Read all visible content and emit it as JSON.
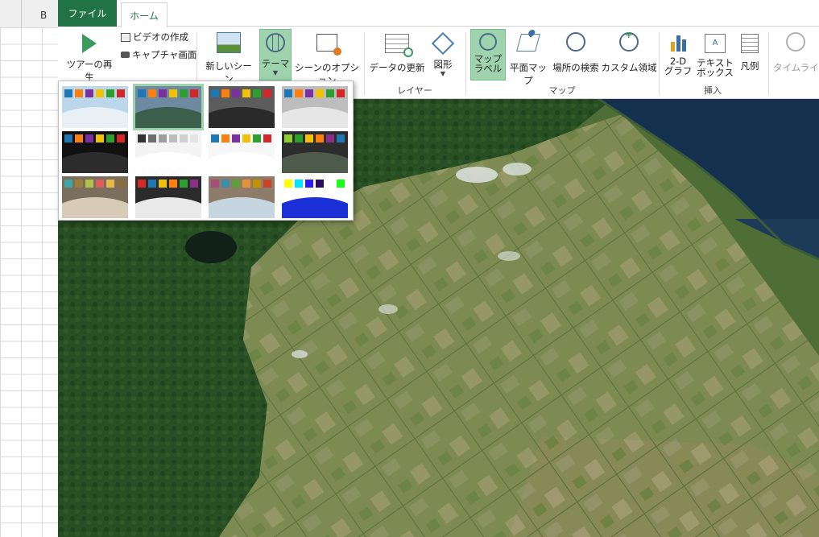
{
  "sheet": {
    "column_label": "B"
  },
  "tabs": {
    "file": "ファイル",
    "home": "ホーム"
  },
  "ribbon": {
    "tour_play": "ツアーの再生",
    "create_video": "ビデオの作成",
    "capture_screen": "キャプチャ画面",
    "new_scene": "新しいシーン",
    "theme": "テーマ",
    "scene_options": "シーンのオプション",
    "refresh_data": "データの更新",
    "shapes": "図形",
    "map_labels_line1": "マップ",
    "map_labels_line2": "ラベル",
    "flat_map": "平面マップ",
    "find_location": "場所の検索",
    "custom_regions": "カスタム領域",
    "chart_2d_line1": "2-D",
    "chart_2d_line2": "グラフ",
    "text_box_line1": "テキスト",
    "text_box_line2": "ボックス",
    "legend": "凡例",
    "timeline": "タイムライン",
    "group_layer": "レイヤー",
    "group_map": "マップ",
    "group_insert": "挿入"
  },
  "theme_gallery": {
    "selected_index": 1,
    "themes": [
      {
        "bg": "#bcd6ea",
        "globe": "#e8f0f6",
        "swatches": [
          "#1f77b4",
          "#ff7f0e",
          "#7b2fa0",
          "#f2c200",
          "#2ca02c",
          "#d62728"
        ]
      },
      {
        "bg": "#6d8aa0",
        "globe": "#3b5f4a",
        "swatches": [
          "#1f77b4",
          "#ff7f0e",
          "#7b2fa0",
          "#f2c200",
          "#2ca02c",
          "#d62728"
        ]
      },
      {
        "bg": "#5c5c5c",
        "globe": "#2a2a2a",
        "swatches": [
          "#1f77b4",
          "#ff7f0e",
          "#7b2fa0",
          "#f2c200",
          "#2ca02c",
          "#d62728"
        ]
      },
      {
        "bg": "#bdbdbd",
        "globe": "#e6e6e6",
        "swatches": [
          "#1f77b4",
          "#ff7f0e",
          "#7b2fa0",
          "#f2c200",
          "#2ca02c",
          "#d62728"
        ]
      },
      {
        "bg": "#111111",
        "globe": "#2c2c2c",
        "swatches": [
          "#1f77b4",
          "#ff7f0e",
          "#7b2fa0",
          "#f2c200",
          "#2ca02c",
          "#d62728"
        ]
      },
      {
        "bg": "#f4f4f4",
        "globe": "#ffffff",
        "swatches": [
          "#333333",
          "#6e6e6e",
          "#9e9e9e",
          "#bdbdbd",
          "#d0d0d0",
          "#e4e4e4"
        ]
      },
      {
        "bg": "#f7f7f7",
        "globe": "#ffffff",
        "swatches": [
          "#1f77b4",
          "#ff7f0e",
          "#7b2fa0",
          "#f2c200",
          "#2ca02c",
          "#d62728"
        ]
      },
      {
        "bg": "#2d2d2d",
        "globe": "#4e5a4a",
        "swatches": [
          "#8cd12e",
          "#2ca02c",
          "#f2c200",
          "#ff7f0e",
          "#8b2f8b",
          "#1f77b4"
        ]
      },
      {
        "bg": "#7a6e5c",
        "globe": "#d8cbb5",
        "swatches": [
          "#3fa5a5",
          "#9b7c3c",
          "#b0c24a",
          "#e05c5c",
          "#e2b84a",
          "#8a6c3e"
        ]
      },
      {
        "bg": "#2b2b2b",
        "globe": "#e9e9e9",
        "swatches": [
          "#d62728",
          "#1f77b4",
          "#f2c200",
          "#ff7f0e",
          "#2ca02c",
          "#8b2f8b"
        ]
      },
      {
        "bg": "#8e7c6a",
        "globe": "#c6d6e0",
        "swatches": [
          "#a64d79",
          "#3b8fa8",
          "#5f9e3a",
          "#e69138",
          "#bf9000",
          "#cc4125"
        ]
      },
      {
        "bg": "#ffffff",
        "globe": "#1d2fd6",
        "swatches": [
          "#ffff00",
          "#00e5ff",
          "#2a1aff",
          "#2c0a5c",
          "#ffffff",
          "#19ff19"
        ]
      }
    ]
  }
}
